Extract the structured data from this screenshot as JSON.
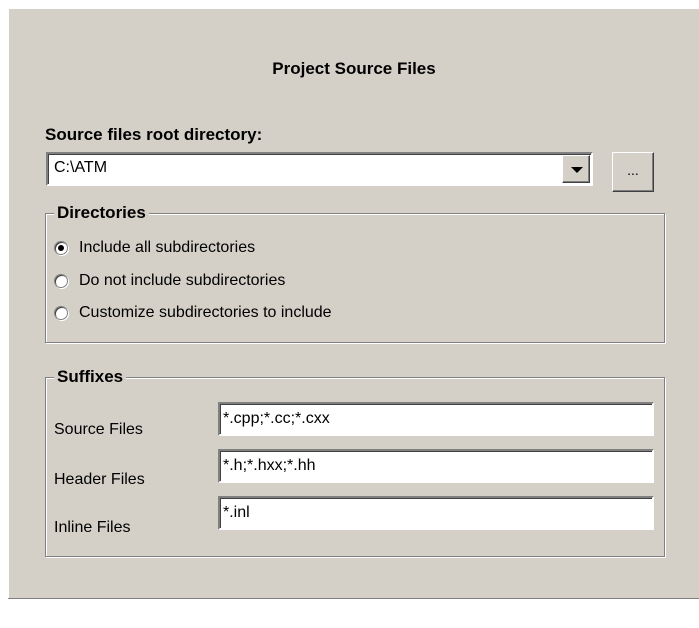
{
  "dialog": {
    "title": "Project Source Files"
  },
  "root_directory": {
    "label": "Source files root directory:",
    "value": "C:\\ATM",
    "browse_label": "..."
  },
  "directories": {
    "title": "Directories",
    "options": [
      {
        "label": "Include all subdirectories",
        "checked": true
      },
      {
        "label": "Do not include subdirectories",
        "checked": false
      },
      {
        "label": "Customize subdirectories to include",
        "checked": false
      }
    ]
  },
  "suffixes": {
    "title": "Suffixes",
    "source": {
      "label": "Source Files",
      "value": "*.cpp;*.cc;*.cxx"
    },
    "header": {
      "label": "Header Files",
      "value": "*.h;*.hxx;*.hh"
    },
    "inline": {
      "label": "Inline Files",
      "value": "*.inl"
    }
  },
  "colors": {
    "face": "#d4d0c8",
    "shadow": "#808080",
    "highlight": "#ffffff"
  }
}
